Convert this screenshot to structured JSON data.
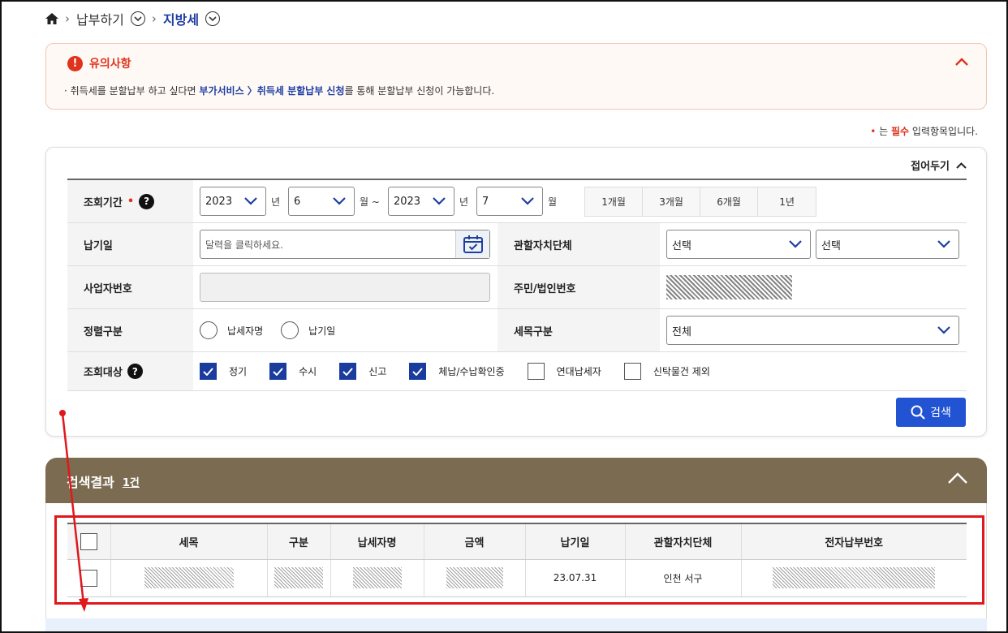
{
  "breadcrumb": {
    "home_icon": "home-icon",
    "level1": "납부하기",
    "level2": "지방세"
  },
  "notice": {
    "title": "유의사항",
    "text_prefix": "· 취득세를 분할납부 하고 싶다면 ",
    "link_text": "부가서비스 〉취득세 분할납부 신청",
    "text_suffix": "를 통해 분할납부 신청이 가능합니다."
  },
  "required_note": {
    "dot": "•",
    "prefix": " 는 ",
    "required": "필수",
    "suffix": " 입력항목입니다."
  },
  "search_panel": {
    "collapse_label": "접어두기",
    "period": {
      "label": "조회기간",
      "from_year": "2023",
      "from_month": "6",
      "to_year": "2023",
      "to_month": "7",
      "year_unit": "년",
      "month_unit_tilde": "월 ~",
      "month_unit": "월",
      "quick_buttons": [
        "1개월",
        "3개월",
        "6개월",
        "1년"
      ]
    },
    "payment_date": {
      "label": "납기일",
      "placeholder": "달력을 클릭하세요."
    },
    "jurisdiction": {
      "label": "관할자치단체",
      "select1": "선택",
      "select2": "선택"
    },
    "business_number": {
      "label": "사업자번호"
    },
    "resident_number": {
      "label": "주민/법인번호"
    },
    "sort": {
      "label": "정렬구분",
      "options": [
        "납세자명",
        "납기일"
      ]
    },
    "tax_item": {
      "label": "세목구분",
      "value": "전체"
    },
    "target": {
      "label": "조회대상",
      "options": [
        {
          "label": "정기",
          "checked": true
        },
        {
          "label": "수시",
          "checked": true
        },
        {
          "label": "신고",
          "checked": true
        },
        {
          "label": "체납/수납확인중",
          "checked": true
        },
        {
          "label": "연대납세자",
          "checked": false
        },
        {
          "label": "신탁물건 제외",
          "checked": false
        }
      ]
    },
    "search_button": "검색"
  },
  "results": {
    "title": "검색결과",
    "count": "1건",
    "columns": [
      "세목",
      "구분",
      "납세자명",
      "금액",
      "납기일",
      "관할자치단체",
      "전자납부번호"
    ],
    "rows": [
      {
        "due_date": "23.07.31",
        "jurisdiction": "인천 서구"
      }
    ]
  },
  "colors": {
    "accent_blue": "#2153d3",
    "results_header": "#7b6c51",
    "alert_red": "#e0321c",
    "annotation_red": "#e0181c"
  }
}
